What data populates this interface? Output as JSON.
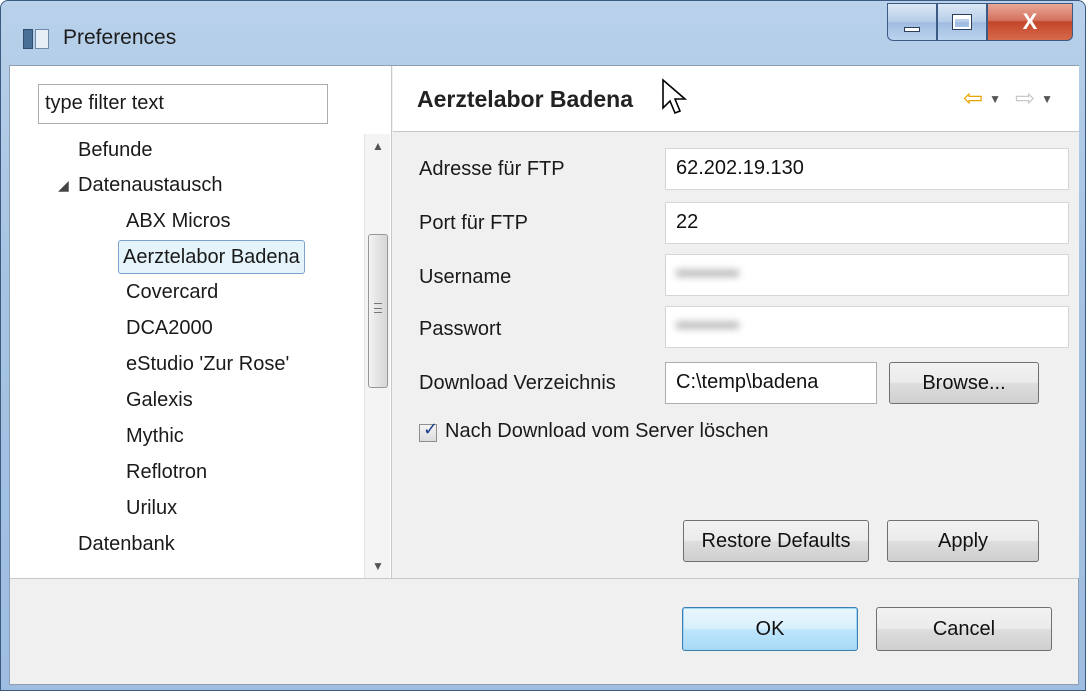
{
  "window": {
    "title": "Preferences",
    "close_glyph": "X"
  },
  "filter": {
    "value": "type filter text"
  },
  "tree": {
    "items": [
      {
        "label": "Befunde",
        "level": 1
      },
      {
        "label": "Datenaustausch",
        "level": 1,
        "expanded": true
      },
      {
        "label": "ABX Micros",
        "level": 2
      },
      {
        "label": "Aerztelabor Badena",
        "level": 2,
        "selected": true
      },
      {
        "label": "Covercard",
        "level": 2
      },
      {
        "label": "DCA2000",
        "level": 2
      },
      {
        "label": "eStudio 'Zur Rose'",
        "level": 2
      },
      {
        "label": "Galexis",
        "level": 2
      },
      {
        "label": "Mythic",
        "level": 2
      },
      {
        "label": "Reflotron",
        "level": 2
      },
      {
        "label": "Urilux",
        "level": 2
      },
      {
        "label": "Datenbank",
        "level": 1
      }
    ]
  },
  "page": {
    "title": "Aerztelabor Badena",
    "fields": {
      "ftp_address_label": "Adresse für FTP",
      "ftp_address_value": "62.202.19.130",
      "ftp_port_label": "Port für FTP",
      "ftp_port_value": "22",
      "username_label": "Username",
      "username_value": "•••••••••",
      "password_label": "Passwort",
      "password_value": "•••••••••",
      "download_dir_label": "Download Verzeichnis",
      "download_dir_value": "C:\\temp\\badena"
    },
    "browse_label": "Browse...",
    "delete_after_download_label": "Nach Download vom Server löschen",
    "delete_after_download_checked": true,
    "restore_defaults_label": "Restore Defaults",
    "apply_label": "Apply"
  },
  "dialog": {
    "ok_label": "OK",
    "cancel_label": "Cancel"
  },
  "icons": {
    "back": "back-arrow-icon",
    "forward": "forward-arrow-icon"
  },
  "colors": {
    "selection_bg": "#e5f3fb",
    "selection_border": "#7da2ce",
    "back_arrow": "#e8a400",
    "default_button": "#bee6fd"
  }
}
